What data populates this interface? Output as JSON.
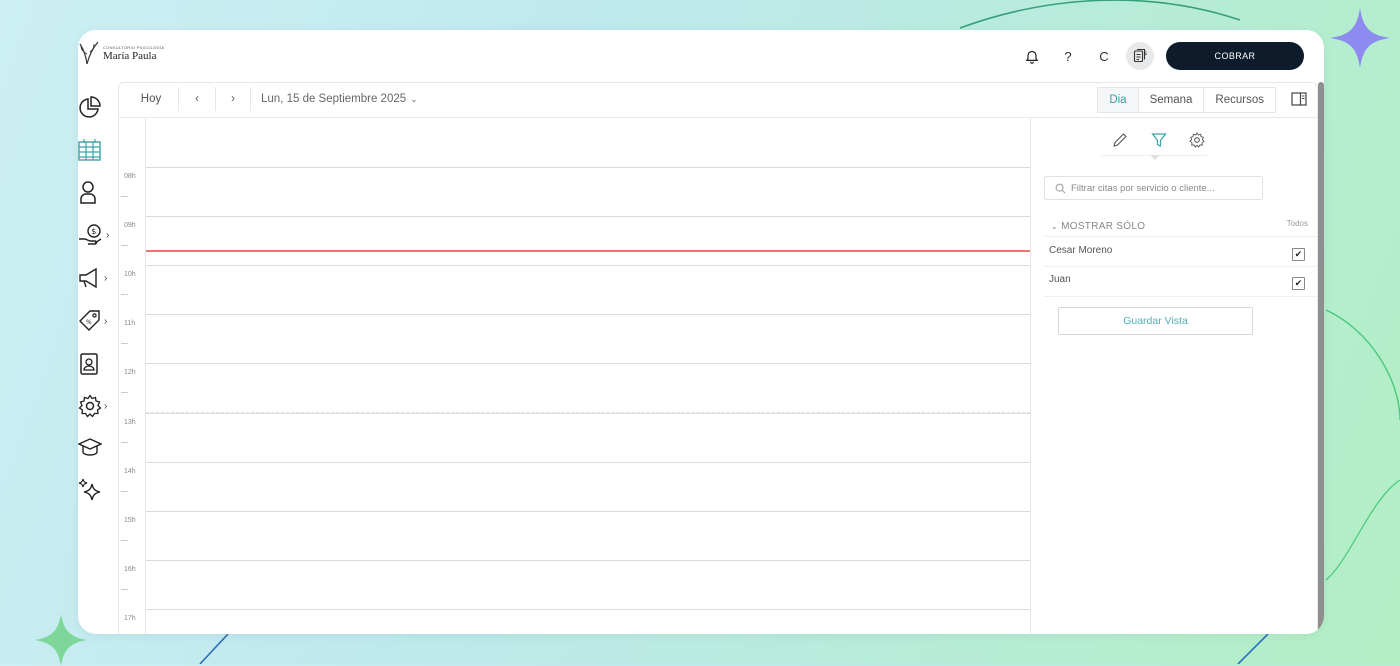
{
  "colors": {
    "accent": "#3aa3a8",
    "now_line": "#e8776b",
    "cobrar_bg": "#0d1b2a",
    "star": "#8d8bf0",
    "star_green": "#7ed79a"
  },
  "header": {
    "logo_small": "CONSULTORIO PSICOLOGÍA",
    "logo_name": "María Paula",
    "icons": [
      "bell-icon",
      "help-icon",
      "user-initial",
      "cash-register-icon"
    ],
    "help_label": "?",
    "user_initial": "C",
    "cobrar_label": "COBRAR"
  },
  "sidebar": {
    "items": [
      {
        "icon": "pie-chart-icon",
        "has_submenu": false,
        "chev": ""
      },
      {
        "icon": "calendar-grid-icon",
        "has_submenu": false,
        "chev": "",
        "active": true
      },
      {
        "icon": "person-icon",
        "has_submenu": false,
        "chev": ""
      },
      {
        "icon": "money-hand-icon",
        "has_submenu": true,
        "chev": "›"
      },
      {
        "icon": "megaphone-icon",
        "has_submenu": true,
        "chev": "›"
      },
      {
        "icon": "tag-icon",
        "has_submenu": true,
        "chev": "›"
      },
      {
        "icon": "contact-card-icon",
        "has_submenu": false,
        "chev": ""
      },
      {
        "icon": "gear-icon",
        "has_submenu": true,
        "chev": "›"
      },
      {
        "icon": "graduation-cap-icon",
        "has_submenu": false,
        "chev": ""
      },
      {
        "icon": "sparkles-icon",
        "has_submenu": false,
        "chev": ""
      }
    ]
  },
  "toolbar": {
    "today_label": "Hoy",
    "prev_label": "‹",
    "next_label": "›",
    "date_label": "Lun, 15 de Septiembre 2025",
    "date_chevron": "⌄",
    "view_tabs": [
      {
        "label": "Dia",
        "active": true
      },
      {
        "label": "Semana",
        "active": false
      },
      {
        "label": "Recursos",
        "active": false
      }
    ]
  },
  "calendar": {
    "hours": [
      "08h",
      "09h",
      "10h",
      "11h",
      "12h",
      "13h",
      "14h",
      "15h",
      "16h",
      "17h"
    ],
    "current_time_indicator": true
  },
  "panel": {
    "tabs": [
      "pencil-icon",
      "filter-icon",
      "gear-icon"
    ],
    "active_tab": "filter-icon",
    "filter_placeholder": "Filtrar citas por servicio o cliente...",
    "mostrar_label": "MOSTRAR SÓLO",
    "mostrar_chevron": "⌄",
    "todos_label": "Todos",
    "employees": [
      {
        "name": "Cesar Moreno",
        "checked": true,
        "mark": "✔"
      },
      {
        "name": "Juan",
        "checked": true,
        "mark": "✔"
      }
    ],
    "guardar_label": "Guardar Vista"
  }
}
